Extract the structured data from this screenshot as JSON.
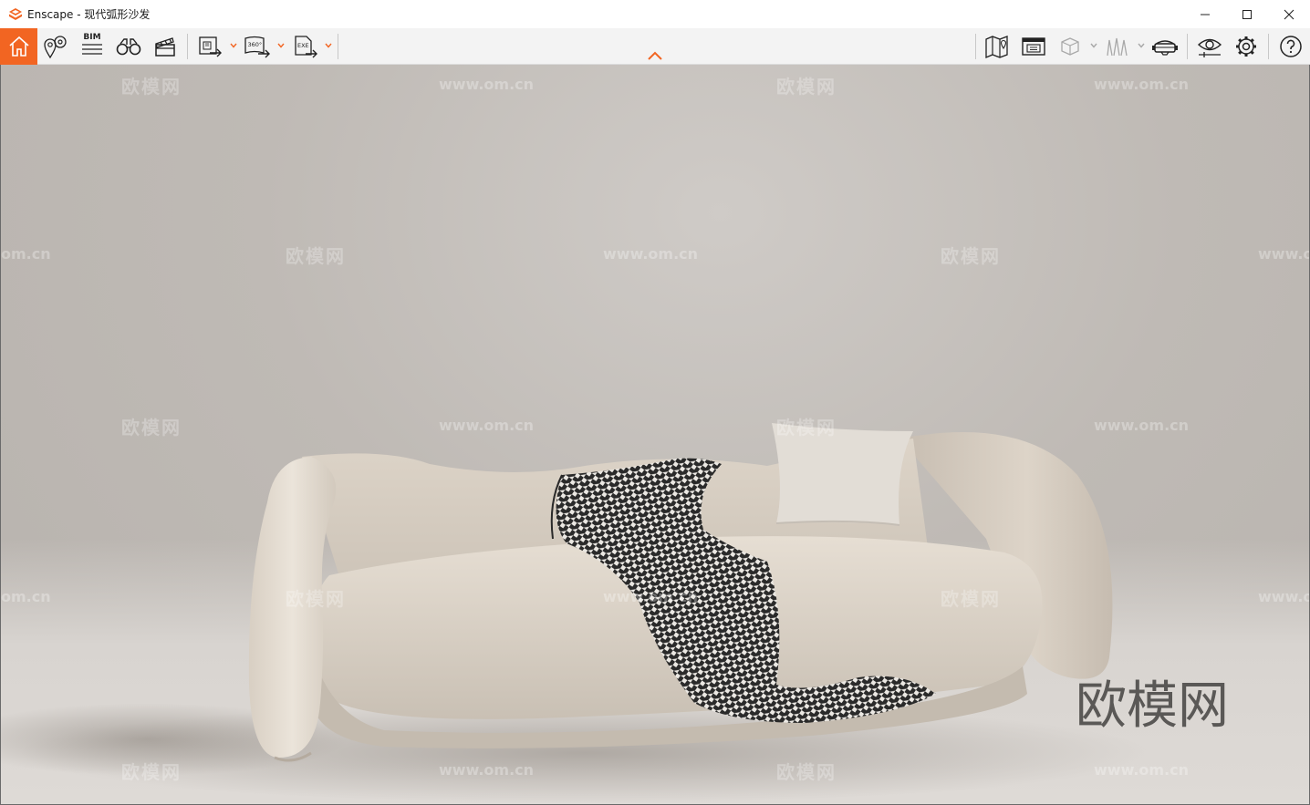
{
  "window": {
    "app_name": "Enscape",
    "title": "Enscape - 现代弧形沙发",
    "controls": [
      "minimize-icon",
      "maximize-icon",
      "close-icon"
    ]
  },
  "toolbar": {
    "left": [
      {
        "name": "home",
        "icon": "home-icon",
        "active": true
      },
      {
        "name": "views",
        "icon": "location-pin-icon"
      },
      {
        "name": "bim",
        "icon": "bim-icon",
        "label": "BIM"
      },
      {
        "name": "binoculars",
        "icon": "binoculars-icon"
      },
      {
        "name": "video-editor",
        "icon": "clapperboard-icon"
      },
      {
        "name": "render-export",
        "icon": "render-export-icon",
        "dropdown": true
      },
      {
        "name": "panorama-export",
        "icon": "panorama-export-icon",
        "label": "360°",
        "dropdown": true
      },
      {
        "name": "exe-export",
        "icon": "exe-export-icon",
        "label": "EXE",
        "dropdown": true
      }
    ],
    "right": [
      {
        "name": "map",
        "icon": "map-icon"
      },
      {
        "name": "asset-library",
        "icon": "asset-library-icon"
      },
      {
        "name": "material-cube",
        "icon": "cube-icon",
        "dropdown": true,
        "disabled": true
      },
      {
        "name": "light-view",
        "icon": "light-view-icon",
        "dropdown": true,
        "disabled": true
      },
      {
        "name": "vr-headset",
        "icon": "vr-headset-icon"
      },
      {
        "name": "visual-settings",
        "icon": "eye-icon"
      },
      {
        "name": "settings",
        "icon": "gear-icon"
      },
      {
        "name": "help",
        "icon": "help-icon"
      }
    ],
    "accent_color": "#f26522"
  },
  "viewport": {
    "watermark_small": "欧模网",
    "watermark_url": "www.om.cn",
    "watermark_edge": "om.cn",
    "watermark_big": "欧模网"
  }
}
